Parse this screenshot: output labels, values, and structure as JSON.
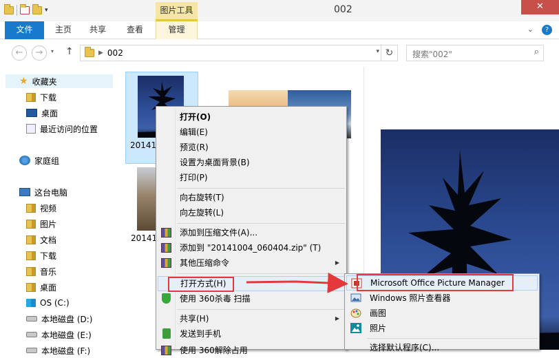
{
  "window": {
    "title": "002",
    "context_tab_group": "图片工具",
    "close_symbol": "✕"
  },
  "ribbon": {
    "tabs": [
      {
        "label": "文件"
      },
      {
        "label": "主页"
      },
      {
        "label": "共享"
      },
      {
        "label": "查看"
      },
      {
        "label": "管理"
      }
    ],
    "collapse_symbol": "⌄",
    "help_symbol": "?"
  },
  "address_bar": {
    "back": "←",
    "forward": "→",
    "up": "↑",
    "path": [
      "002"
    ],
    "refresh": "↻",
    "search_placeholder": "搜索\"002\"",
    "search_symbol": "⌕"
  },
  "nav_pane": {
    "items": [
      {
        "label": "收藏夹"
      },
      {
        "label": "下载"
      },
      {
        "label": "桌面"
      },
      {
        "label": "最近访问的位置"
      },
      {
        "label": "家庭组"
      },
      {
        "label": "这台电脑"
      },
      {
        "label": "视频"
      },
      {
        "label": "图片"
      },
      {
        "label": "文档"
      },
      {
        "label": "下载"
      },
      {
        "label": "音乐"
      },
      {
        "label": "桌面"
      },
      {
        "label": "OS (C:)"
      },
      {
        "label": "本地磁盘 (D:)"
      },
      {
        "label": "本地磁盘 (E:)"
      },
      {
        "label": "本地磁盘 (F:)"
      }
    ]
  },
  "files": [
    {
      "name": "20141"
    },
    {
      "name": ""
    },
    {
      "name": ""
    },
    {
      "name": "20141"
    }
  ],
  "context_menu": {
    "items": [
      {
        "label": "打开(O)"
      },
      {
        "label": "编辑(E)"
      },
      {
        "label": "预览(R)"
      },
      {
        "label": "设置为桌面背景(B)"
      },
      {
        "label": "打印(P)"
      },
      {
        "label": "向右旋转(T)"
      },
      {
        "label": "向左旋转(L)"
      },
      {
        "label": "添加到压缩文件(A)..."
      },
      {
        "label": "添加到 \"20141004_060404.zip\" (T)"
      },
      {
        "label": "其他压缩命令"
      },
      {
        "label": "打开方式(H)"
      },
      {
        "label": "使用 360杀毒 扫描"
      },
      {
        "label": "共享(H)"
      },
      {
        "label": "发送到手机"
      },
      {
        "label": "使用 360解除占用"
      }
    ],
    "submenu_arrow": "▶"
  },
  "open_with_submenu": {
    "items": [
      {
        "label": "Microsoft Office Picture Manager"
      },
      {
        "label": "Windows 照片查看器"
      },
      {
        "label": "画图"
      },
      {
        "label": "照片"
      },
      {
        "label": "选择默认程序(C)..."
      }
    ]
  },
  "colors": {
    "accent": "#1979ca",
    "annotation": "#e5383a",
    "highlight": "#e6eef7"
  }
}
